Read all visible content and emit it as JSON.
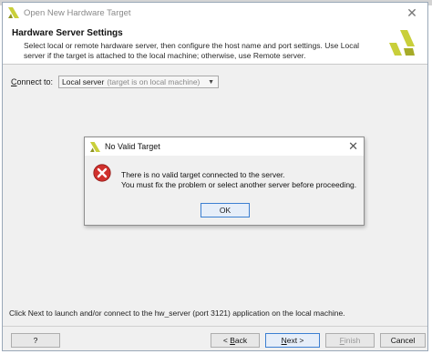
{
  "window": {
    "title": "Open New Hardware Target",
    "close_glyph": "✕"
  },
  "header": {
    "title": "Hardware Server Settings",
    "description": "Select local or remote hardware server, then configure the host name and port settings. Use Local server if the target is attached to the local machine; otherwise, use Remote server.",
    "logo_icon": "vivado-logo-icon",
    "brand_color": "#c9cf3a"
  },
  "connect": {
    "label": "Connect to:",
    "selected_value": "Local server",
    "selected_hint": "(target is on local machine)"
  },
  "bottom_message": "Click Next to launch and/or connect to the hw_server (port 3121) application on the local machine.",
  "buttons": {
    "help": "?",
    "back_prefix": "< ",
    "back_key": "B",
    "back_rest": "ack",
    "next_key": "N",
    "next_rest": "ext >",
    "finish_key": "F",
    "finish_rest": "inish",
    "cancel": "Cancel"
  },
  "dialog": {
    "title": "No Valid Target",
    "line1": "There is no valid target connected to the server.",
    "line2": "You must fix the problem or select another server before proceeding.",
    "ok_label": "OK",
    "error_icon": "error-icon",
    "error_color": "#d0312d"
  }
}
